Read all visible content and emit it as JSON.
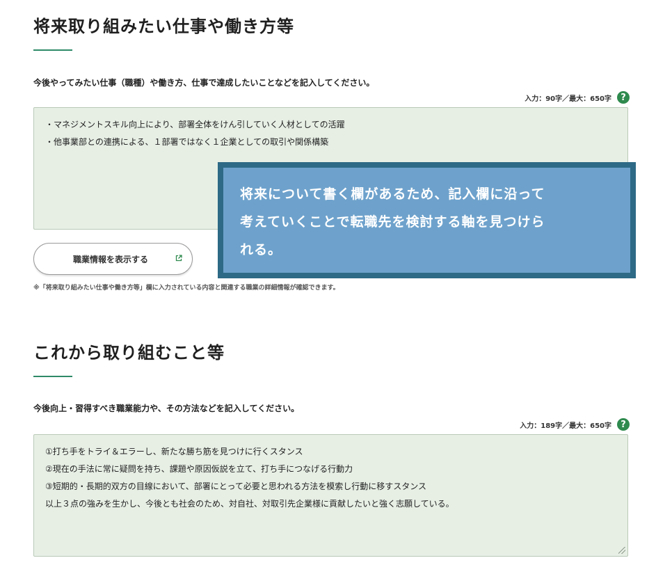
{
  "section1": {
    "title": "将来取り組みたい仕事や働き方等",
    "instruction": "今後やってみたい仕事（職種）や働き方、仕事で達成したいことなどを記入してください。",
    "counter_input": "入力：90字",
    "counter_sep": "／",
    "counter_max": "最大：650字",
    "help_icon": "?",
    "textarea_lines": [
      "・マネジメントスキル向上により、部署全体をけん引していく人材としての活躍",
      "・他事業部との連携による、１部署ではなく１企業としての取引や関係構築"
    ],
    "button_label": "職業情報を表示する",
    "button_icon": "external-link-icon",
    "note": "※「将来取り組みたい仕事や働き方等」欄に入力されている内容と関連する職業の詳細情報が確認できます。"
  },
  "callout": {
    "lines": [
      "将来について書く欄があるため、記入欄に沿って",
      "考えていくことで転職先を検討する軸を見つけら",
      "れる。"
    ]
  },
  "section2": {
    "title": "これから取り組むこと等",
    "instruction": "今後向上・習得すべき職業能力や、その方法などを記入してください。",
    "counter_input": "入力：189字",
    "counter_sep": "／",
    "counter_max": "最大：650字",
    "help_icon": "?",
    "textarea_lines": [
      "①打ち手をトライ＆エラーし、新たな勝ち筋を見つけに行くスタンス",
      "②現在の手法に常に疑問を持ち、課題や原因仮説を立て、打ち手につなげる行動力",
      "③短期的・長期的双方の目線において、部署にとって必要と思われる方法を模索し行動に移すスタンス",
      "以上３点の強みを生かし、今後とも社会のため、対自社、対取引先企業様に貢献したいと強く志願している。"
    ]
  },
  "colors": {
    "accent_green": "#2e8a67",
    "textarea_bg": "#e7efe5",
    "callout_border": "#2e6a86",
    "callout_bg": "#6ea2cc"
  }
}
